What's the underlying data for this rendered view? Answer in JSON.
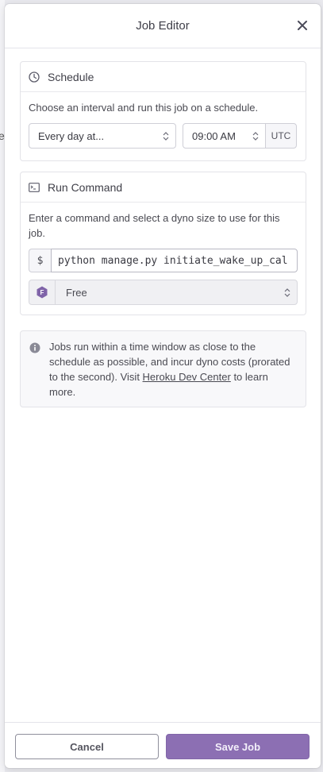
{
  "window": {
    "title": "Job Editor"
  },
  "background": {
    "peek_char": "e"
  },
  "schedule": {
    "heading": "Schedule",
    "description": "Choose an interval and run this job on a schedule.",
    "interval_value": "Every day at...",
    "time_value": "09:00 AM",
    "timezone": "UTC"
  },
  "run_command": {
    "heading": "Run Command",
    "description": "Enter a command and select a dyno size to use for this job.",
    "prompt_symbol": "$",
    "command_value": "python manage.py initiate_wake_up_cal",
    "dyno_badge": "F",
    "dyno_size": "Free"
  },
  "info": {
    "text_before_link": "Jobs run within a time window as close to the schedule as possible, and incur dyno costs (prorated to the second). Visit ",
    "link_text": "Heroku Dev Center",
    "text_after_link": " to learn more."
  },
  "footer": {
    "cancel_label": "Cancel",
    "save_label": "Save Job"
  },
  "colors": {
    "primary_button": "#8c6fb3",
    "dyno_badge": "#7f63a8"
  }
}
